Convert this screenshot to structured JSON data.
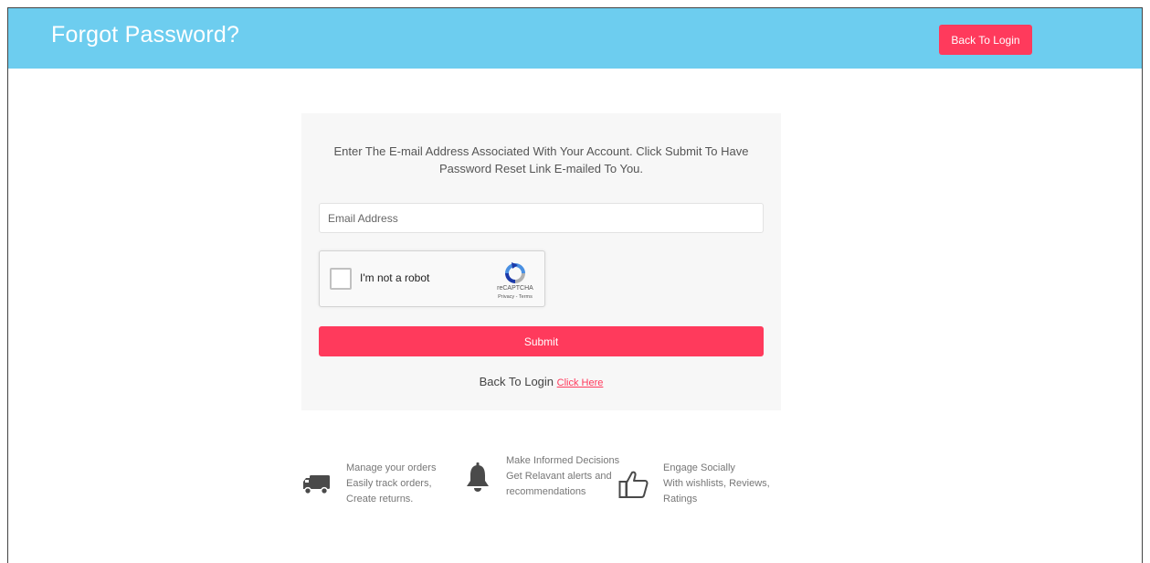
{
  "header": {
    "title": "Forgot Password?",
    "back_button": "Back To Login",
    "bg_color": "#6dcdef",
    "accent_color": "#ff3a5c"
  },
  "form": {
    "instructions": "Enter The E-mail Address Associated With Your Account. Click Submit To Have Password Reset Link E-mailed To You.",
    "email_placeholder": "Email Address",
    "email_value": "",
    "captcha": {
      "label": "I'm not a robot",
      "brand": "reCAPTCHA",
      "links": "Privacy - Terms",
      "icon": "recaptcha-icon"
    },
    "submit_label": "Submit",
    "back_text": "Back To Login",
    "back_link": "Click Here"
  },
  "features": [
    {
      "icon": "truck-icon",
      "title": "Manage your orders",
      "desc": "Easily track orders, Create returns."
    },
    {
      "icon": "bell-icon",
      "title": "Make Informed Decisions",
      "desc": "Get Relavant alerts and recommendations"
    },
    {
      "icon": "thumbs-up-icon",
      "title": "Engage Socially",
      "desc": "With wishlists, Reviews, Ratings"
    }
  ]
}
